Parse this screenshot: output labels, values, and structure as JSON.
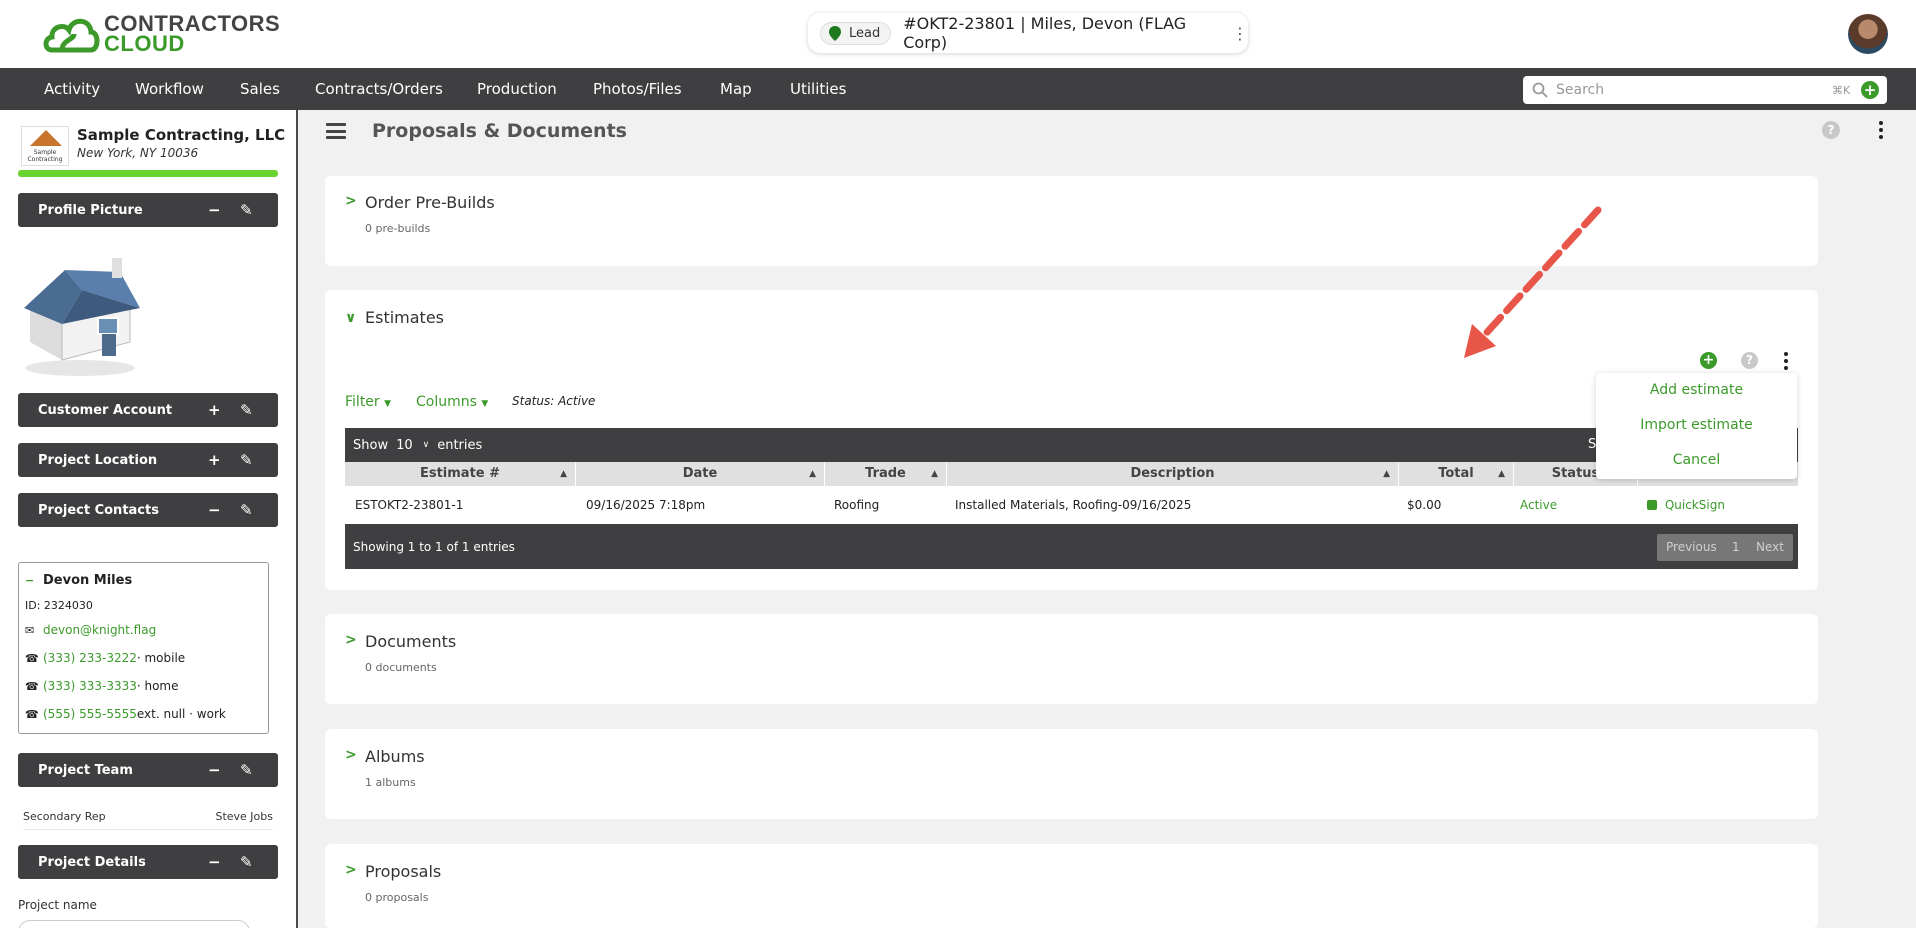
{
  "brand": {
    "line1": "CONTRACTORS",
    "line2": "CLOUD"
  },
  "header": {
    "lead_badge": "Lead",
    "job_title": "#OKT2-23801 | Miles, Devon (FLAG Corp)",
    "kebab": "⋮"
  },
  "nav": {
    "items": [
      "Activity",
      "Workflow",
      "Sales",
      "Contracts/Orders",
      "Production",
      "Photos/Files",
      "Map",
      "Utilities"
    ],
    "search_placeholder": "Search",
    "search_shortcut": "⌘K"
  },
  "sidebar": {
    "company_name": "Sample Contracting, LLC",
    "company_address": "New York, NY 10036",
    "company_logo_text": "Sample Contracting",
    "sections": {
      "profile_picture": "Profile Picture",
      "customer_account": "Customer Account",
      "project_location": "Project Location",
      "project_contacts": "Project Contacts",
      "project_team": "Project Team",
      "project_details": "Project Details"
    },
    "contact": {
      "name": "Devon Miles",
      "id": "ID: 2324030",
      "email": "devon@knight.flag",
      "phones": [
        {
          "number": "(333) 233-3222",
          "suffix": " · mobile"
        },
        {
          "number": "(333) 333-3333",
          "suffix": " · home"
        },
        {
          "number": "(555) 555-5555",
          "suffix": " ext. null · work"
        }
      ]
    },
    "team": {
      "role": "Secondary Rep",
      "person": "Steve Jobs"
    },
    "project_name_label": "Project name"
  },
  "main": {
    "title": "Proposals & Documents",
    "order_prebuilds": {
      "title": "Order Pre-Builds",
      "sub": "0 pre-builds"
    },
    "estimates": {
      "title": "Estimates",
      "filter": "Filter",
      "columns": "Columns",
      "status_note": "Status: Active",
      "show": "Show",
      "entries_count": "10",
      "entries": "entries",
      "search_partial": "S",
      "headers": [
        "Estimate #",
        "Date",
        "Trade",
        "Description",
        "Total",
        "Status"
      ],
      "row": {
        "estimate": "ESTOKT2-23801-1",
        "date": "09/16/2025 7:18pm",
        "trade": "Roofing",
        "description": "Installed Materials, Roofing-09/16/2025",
        "total": "$0.00",
        "status": "Active",
        "action": "QuickSign"
      },
      "footer": "Showing 1 to 1 of 1 entries",
      "pagination": {
        "previous": "Previous",
        "page": "1",
        "next": "Next"
      },
      "menu": [
        "Add estimate",
        "Import estimate",
        "Cancel"
      ]
    },
    "documents": {
      "title": "Documents",
      "sub": "0 documents"
    },
    "albums": {
      "title": "Albums",
      "sub": "1 albums"
    },
    "proposals": {
      "title": "Proposals",
      "sub": "0 proposals"
    }
  },
  "colors": {
    "accent": "#3c9a2b",
    "nav": "#3f3f41",
    "arrow": "#e8564a"
  }
}
